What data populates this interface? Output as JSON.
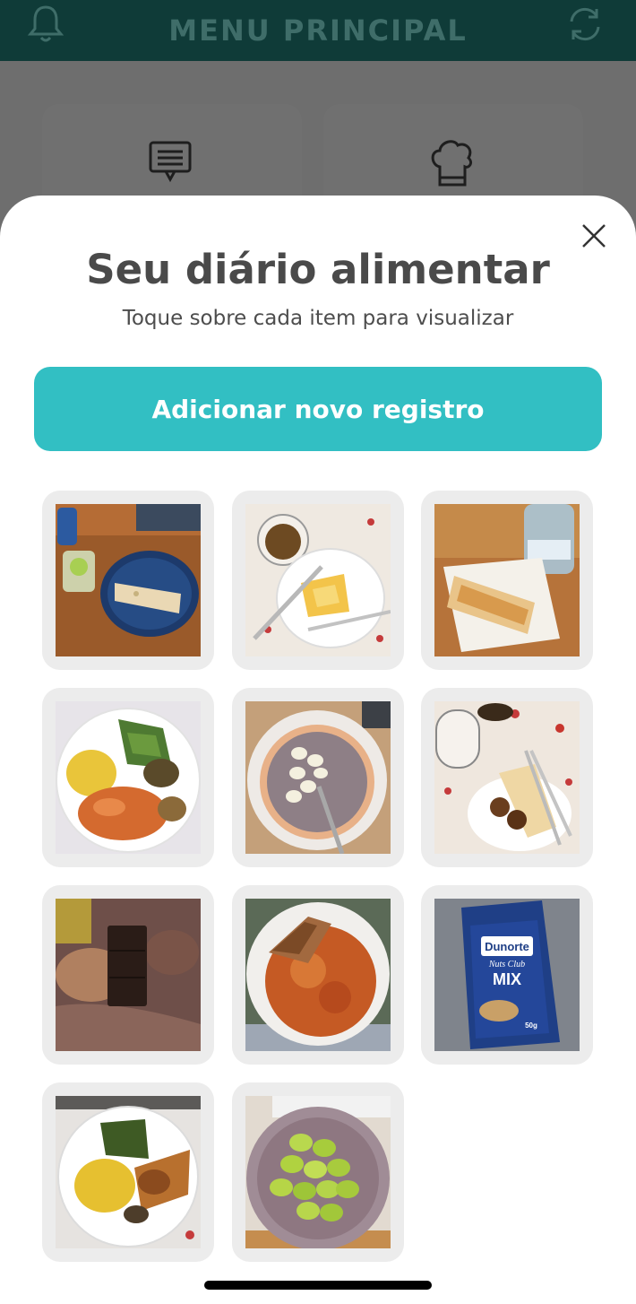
{
  "header": {
    "title": "MENU PRINCIPAL",
    "left_icon": "bell-icon",
    "right_icon": "refresh-icon"
  },
  "background_cards": [
    {
      "icon": "chat-icon"
    },
    {
      "icon": "chef-hat-icon"
    }
  ],
  "sheet": {
    "title": "Seu diário alimentar",
    "subtitle": "Toque sobre cada item para visualizar",
    "add_button_label": "Adicionar novo registro",
    "close_icon": "close-icon"
  },
  "entries": [
    {
      "photo": "bread-plate-and-drinks"
    },
    {
      "photo": "omelette-plate-with-cup"
    },
    {
      "photo": "wrap-on-paper-with-water-bottle"
    },
    {
      "photo": "rice-salad-chicken-plate"
    },
    {
      "photo": "porridge-bowl-with-banana"
    },
    {
      "photo": "crepe-plate-with-cup"
    },
    {
      "photo": "chocolate-bar-in-hand"
    },
    {
      "photo": "pasta-with-chicken-bowl"
    },
    {
      "photo": "dunorte-nuts-mix-package"
    },
    {
      "photo": "rice-chicken-salad-plate"
    },
    {
      "photo": "green-grapes-bowl"
    }
  ],
  "package_text": {
    "brand": "Dunorte",
    "sub": "Nuts Club",
    "name": "MIX",
    "weight": "50g"
  },
  "colors": {
    "header_bg": "#0f3b38",
    "accent": "#32bfc3",
    "tile_bg": "#ececec"
  }
}
